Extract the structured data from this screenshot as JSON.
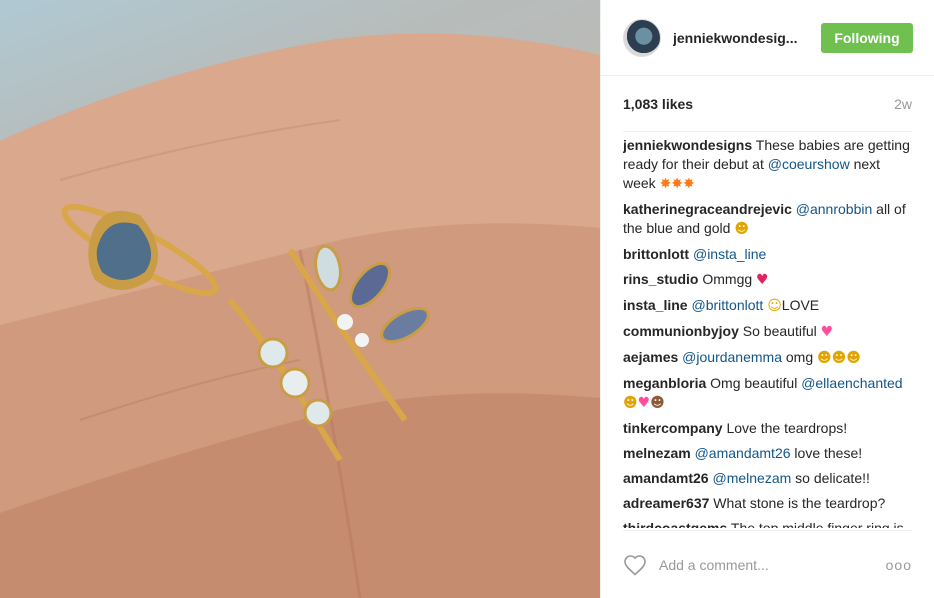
{
  "header": {
    "username": "jenniekwondesig...",
    "follow_label": "Following"
  },
  "stats": {
    "likes": "1,083 likes",
    "age": "2w"
  },
  "comments": [
    {
      "author": "jenniekwondesigns",
      "parts": [
        {
          "t": " These babies are getting ready for their debut at "
        },
        {
          "m": "@coeurshow"
        },
        {
          "t": " next week "
        },
        {
          "e": "✸✸✸",
          "c": "e-orange"
        }
      ]
    },
    {
      "author": "katherinegraceandrejevic",
      "parts": [
        {
          "t": " "
        },
        {
          "m": "@annrobbin"
        },
        {
          "t": " all of the blue and gold "
        },
        {
          "e": "☻",
          "c": "e-yel"
        }
      ]
    },
    {
      "author": "brittonlott",
      "parts": [
        {
          "t": " "
        },
        {
          "m": "@insta_line"
        }
      ]
    },
    {
      "author": "rins_studio",
      "parts": [
        {
          "t": " Ommgg "
        },
        {
          "e": "♥",
          "c": "e-red"
        }
      ]
    },
    {
      "author": "insta_line",
      "parts": [
        {
          "t": " "
        },
        {
          "m": "@brittonlott"
        },
        {
          "t": " "
        },
        {
          "e": "☺",
          "c": "e-yel"
        },
        {
          "t": "LOVE"
        }
      ]
    },
    {
      "author": "communionbyjoy",
      "parts": [
        {
          "t": " So beautiful "
        },
        {
          "e": "♥",
          "c": "e-pink"
        }
      ]
    },
    {
      "author": "aejames",
      "parts": [
        {
          "t": " "
        },
        {
          "m": "@jourdanemma"
        },
        {
          "t": " omg "
        },
        {
          "e": "☻☻☻",
          "c": "e-yel"
        }
      ]
    },
    {
      "author": "meganbloria",
      "parts": [
        {
          "t": " Omg beautiful "
        },
        {
          "m": "@ellaenchanted"
        },
        {
          "t": " "
        },
        {
          "e": "☻",
          "c": "e-yel"
        },
        {
          "e": "♥",
          "c": "e-pink"
        },
        {
          "e": "☻",
          "c": "e-brown"
        }
      ]
    },
    {
      "author": "tinkercompany",
      "parts": [
        {
          "t": " Love the teardrops!"
        }
      ]
    },
    {
      "author": "melnezam",
      "parts": [
        {
          "t": " "
        },
        {
          "m": "@amandamt26"
        },
        {
          "t": " love these!"
        }
      ]
    },
    {
      "author": "amandamt26",
      "parts": [
        {
          "t": " "
        },
        {
          "m": "@melnezam"
        },
        {
          "t": " so delicate!!"
        }
      ]
    },
    {
      "author": "adreamer637",
      "parts": [
        {
          "t": " What stone is the teardrop?"
        }
      ]
    },
    {
      "author": "thirdcoastgems",
      "parts": [
        {
          "t": " The top middle finger ring is my FAVORITE, Jennie!!!! "
        },
        {
          "e": "☻☻☻",
          "c": "e-yel"
        },
        {
          "e": "💯💯💯",
          "c": "e-red"
        }
      ]
    }
  ],
  "footer": {
    "add_comment_placeholder": "Add a comment...",
    "more_label": "ooo"
  },
  "icons": {
    "like": "heart-outline-icon",
    "more": "ellipsis-icon"
  },
  "colors": {
    "follow_button": "#70c050",
    "mention": "#125688",
    "muted": "#999999"
  }
}
